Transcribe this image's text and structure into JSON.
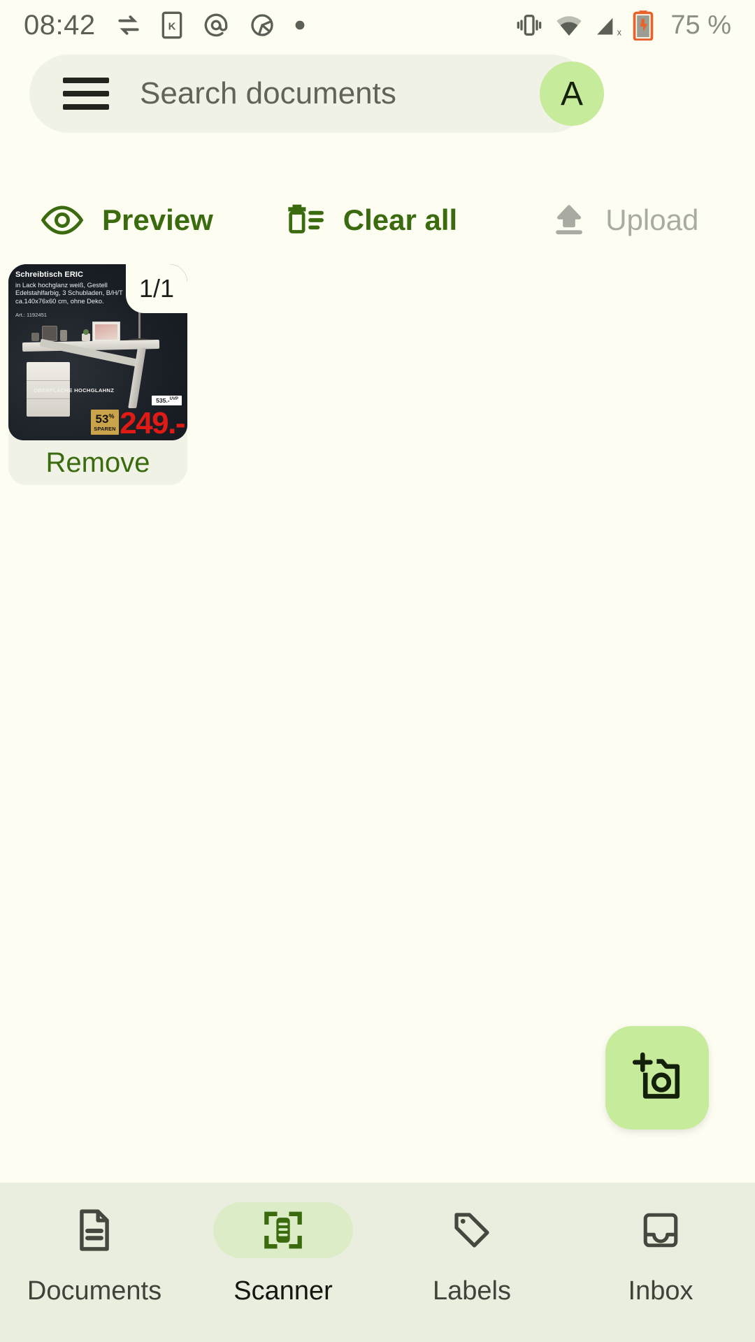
{
  "status_bar": {
    "time": "08:42",
    "battery_percent": "75 %",
    "left_icons": [
      "sync-icon",
      "sd-card-icon",
      "email-at-icon",
      "data-saver-icon",
      "dot-icon"
    ],
    "right_icons": [
      "vibrate-icon",
      "wifi-icon",
      "cellular-off-icon",
      "battery-charging-icon"
    ]
  },
  "search": {
    "placeholder": "Search documents",
    "value": "",
    "menu_icon": "hamburger-menu-icon",
    "avatar_initial": "A"
  },
  "toolbar": {
    "preview_label": "Preview",
    "preview_icon": "eye-icon",
    "clear_all_label": "Clear all",
    "clear_all_icon": "trash-list-icon",
    "upload_label": "Upload",
    "upload_icon": "upload-icon",
    "upload_disabled": true
  },
  "document_card": {
    "page_badge": "1/1",
    "remove_label": "Remove",
    "thumbnail": {
      "alt": "Schreibtisch ERIC furniture advertisement scan",
      "title": "Schreibtisch ERIC",
      "description": "in Lack hochglanz weiß, Gestell Edelstahlfarbig, 3 Schubladen, B/H/T ca.140x76x60 cm, ohne Deko.",
      "article": "Art.: 1192451",
      "surface_text": "OBERFLÄCHE HOCHGLAHNZ",
      "discount_percent": "53",
      "discount_percent_symbol": "%",
      "discount_word": "SPAREN",
      "list_price": "535.-",
      "list_price_label": "UVP",
      "price": "249.-"
    }
  },
  "fab": {
    "icon": "add-a-photo-icon",
    "color": "#c6eb9b"
  },
  "bottom_nav": {
    "items": [
      {
        "label": "Documents",
        "icon": "document-icon",
        "active": false
      },
      {
        "label": "Scanner",
        "icon": "scanner-icon",
        "active": true
      },
      {
        "label": "Labels",
        "icon": "tag-icon",
        "active": false
      },
      {
        "label": "Inbox",
        "icon": "inbox-icon",
        "active": false
      }
    ]
  },
  "colors": {
    "background": "#fdfdf2",
    "surface": "#f0f2e6",
    "accent_green": "#3a6b0e",
    "accent_light_green": "#c6eb9b",
    "nav_background": "#eaeede",
    "disabled_gray": "#a9aba2",
    "price_red": "#e01b16"
  }
}
